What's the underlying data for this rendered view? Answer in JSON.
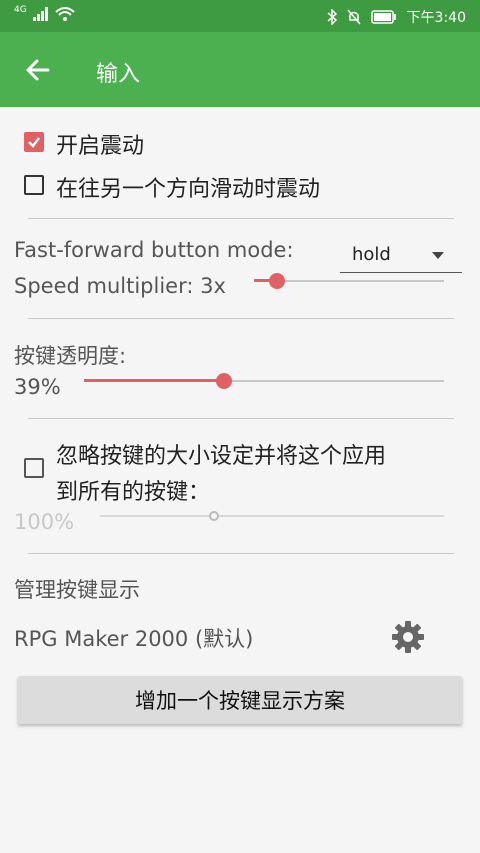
{
  "status_bar": {
    "network": "4G",
    "time": "下午3:40",
    "icons": [
      "signal-icon",
      "wifi-icon",
      "bluetooth-icon",
      "mute-icon",
      "battery-icon"
    ]
  },
  "toolbar": {
    "title": "输入",
    "back_icon": "arrow-left-icon",
    "background": "#4caf50"
  },
  "vibration": {
    "enable_label": "开启震动",
    "enable_checked": true,
    "swipe_label": "在往另一个方向滑动时震动",
    "swipe_checked": false
  },
  "fast_forward": {
    "label": "Fast-forward button mode:",
    "selected": "hold",
    "speed_label": "Speed multiplier: 3x",
    "speed_fraction": 0.12
  },
  "opacity": {
    "label": "按键透明度:",
    "value_text": "39%",
    "fraction": 0.39
  },
  "size": {
    "ignore_label_line1": "忽略按键的大小设定并将这个应用",
    "ignore_label_line2": "到所有的按键：",
    "ignore_checked": false,
    "value_text": "100%",
    "fraction": 0.33
  },
  "manage": {
    "header": "管理按键显示",
    "layout_name": "RPG Maker 2000 (默认)",
    "settings_icon": "gear-icon",
    "add_button_label": "增加一个按键显示方案"
  },
  "accent_color": "#e06163"
}
